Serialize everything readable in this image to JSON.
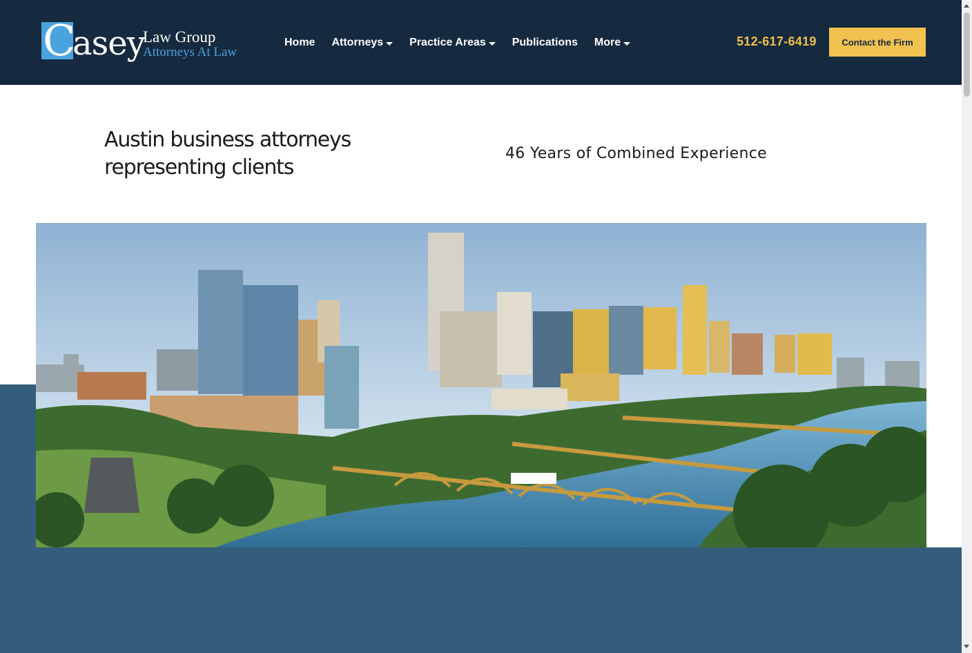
{
  "header": {
    "logo": {
      "letter": "C",
      "name_rest": "asey",
      "line1": "Law Group",
      "line2": "Attorneys At Law"
    },
    "nav": [
      {
        "label": "Home",
        "dropdown": false
      },
      {
        "label": "Attorneys",
        "dropdown": true
      },
      {
        "label": "Practice Areas",
        "dropdown": true
      },
      {
        "label": "Publications",
        "dropdown": false
      },
      {
        "label": "More",
        "dropdown": true
      }
    ],
    "phone": "512-617-6419",
    "cta_label": "Contact the Firm"
  },
  "hero": {
    "headline": "Austin business attorneys representing clients",
    "subheadline": "46 Years of Combined Experience",
    "image_subject": "austin-skyline-photo"
  },
  "colors": {
    "header_bg": "#15293f",
    "accent_gold": "#f2c251",
    "phone_gold": "#f0c04a",
    "logo_blue": "#4aa3df",
    "band_blue": "#345c7b"
  }
}
